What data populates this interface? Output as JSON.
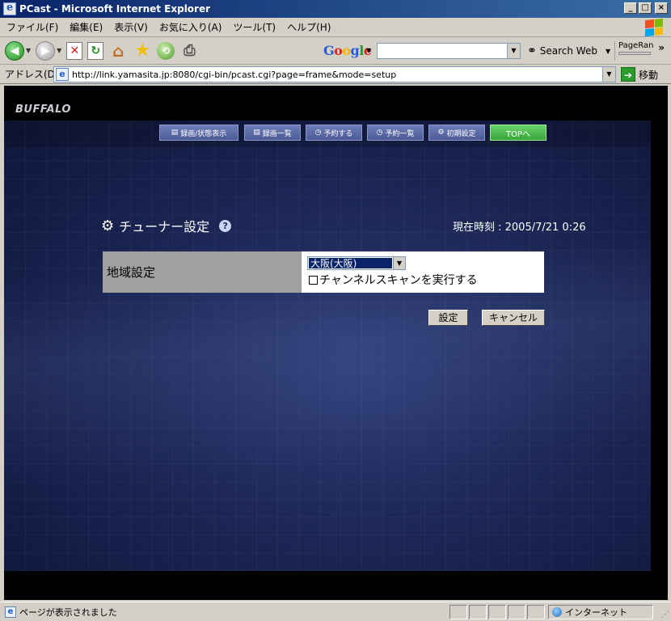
{
  "window": {
    "title": "PCast - Microsoft Internet Explorer",
    "buttons": [
      "_",
      "□",
      "×"
    ]
  },
  "menu": [
    "ファイル(F)",
    "編集(E)",
    "表示(V)",
    "お気に入り(A)",
    "ツール(T)",
    "ヘルプ(H)"
  ],
  "toolbar": {
    "google_label": "Google",
    "search_web": "Search Web",
    "pagerank": "PageRan",
    "more": "»"
  },
  "address": {
    "label": "アドレス(D)",
    "url": "http://link.yamasita.jp:8080/cgi-bin/pcast.cgi?page=frame&mode=setup",
    "go": "移動"
  },
  "page": {
    "brand": "BUFFALO",
    "nav": [
      {
        "label": "録画/状態表示",
        "icon": "▤"
      },
      {
        "label": "録画一覧",
        "icon": "▤"
      },
      {
        "label": "予約する",
        "icon": "◷"
      },
      {
        "label": "予約一覧",
        "icon": "◷"
      },
      {
        "label": "初期設定",
        "icon": "⚙"
      },
      {
        "label": "TOPへ",
        "icon": ""
      }
    ],
    "heading": "チューナー設定",
    "help": "?",
    "clock": "現在時刻 : 2005/7/21 0:26",
    "setting_label": "地域設定",
    "region_value": "大阪(大阪)",
    "scan_label": "チャンネルスキャンを実行する",
    "buttons": {
      "ok": "設定",
      "cancel": "キャンセル"
    }
  },
  "status": {
    "text": "ページが表示されました",
    "zone": "インターネット"
  }
}
